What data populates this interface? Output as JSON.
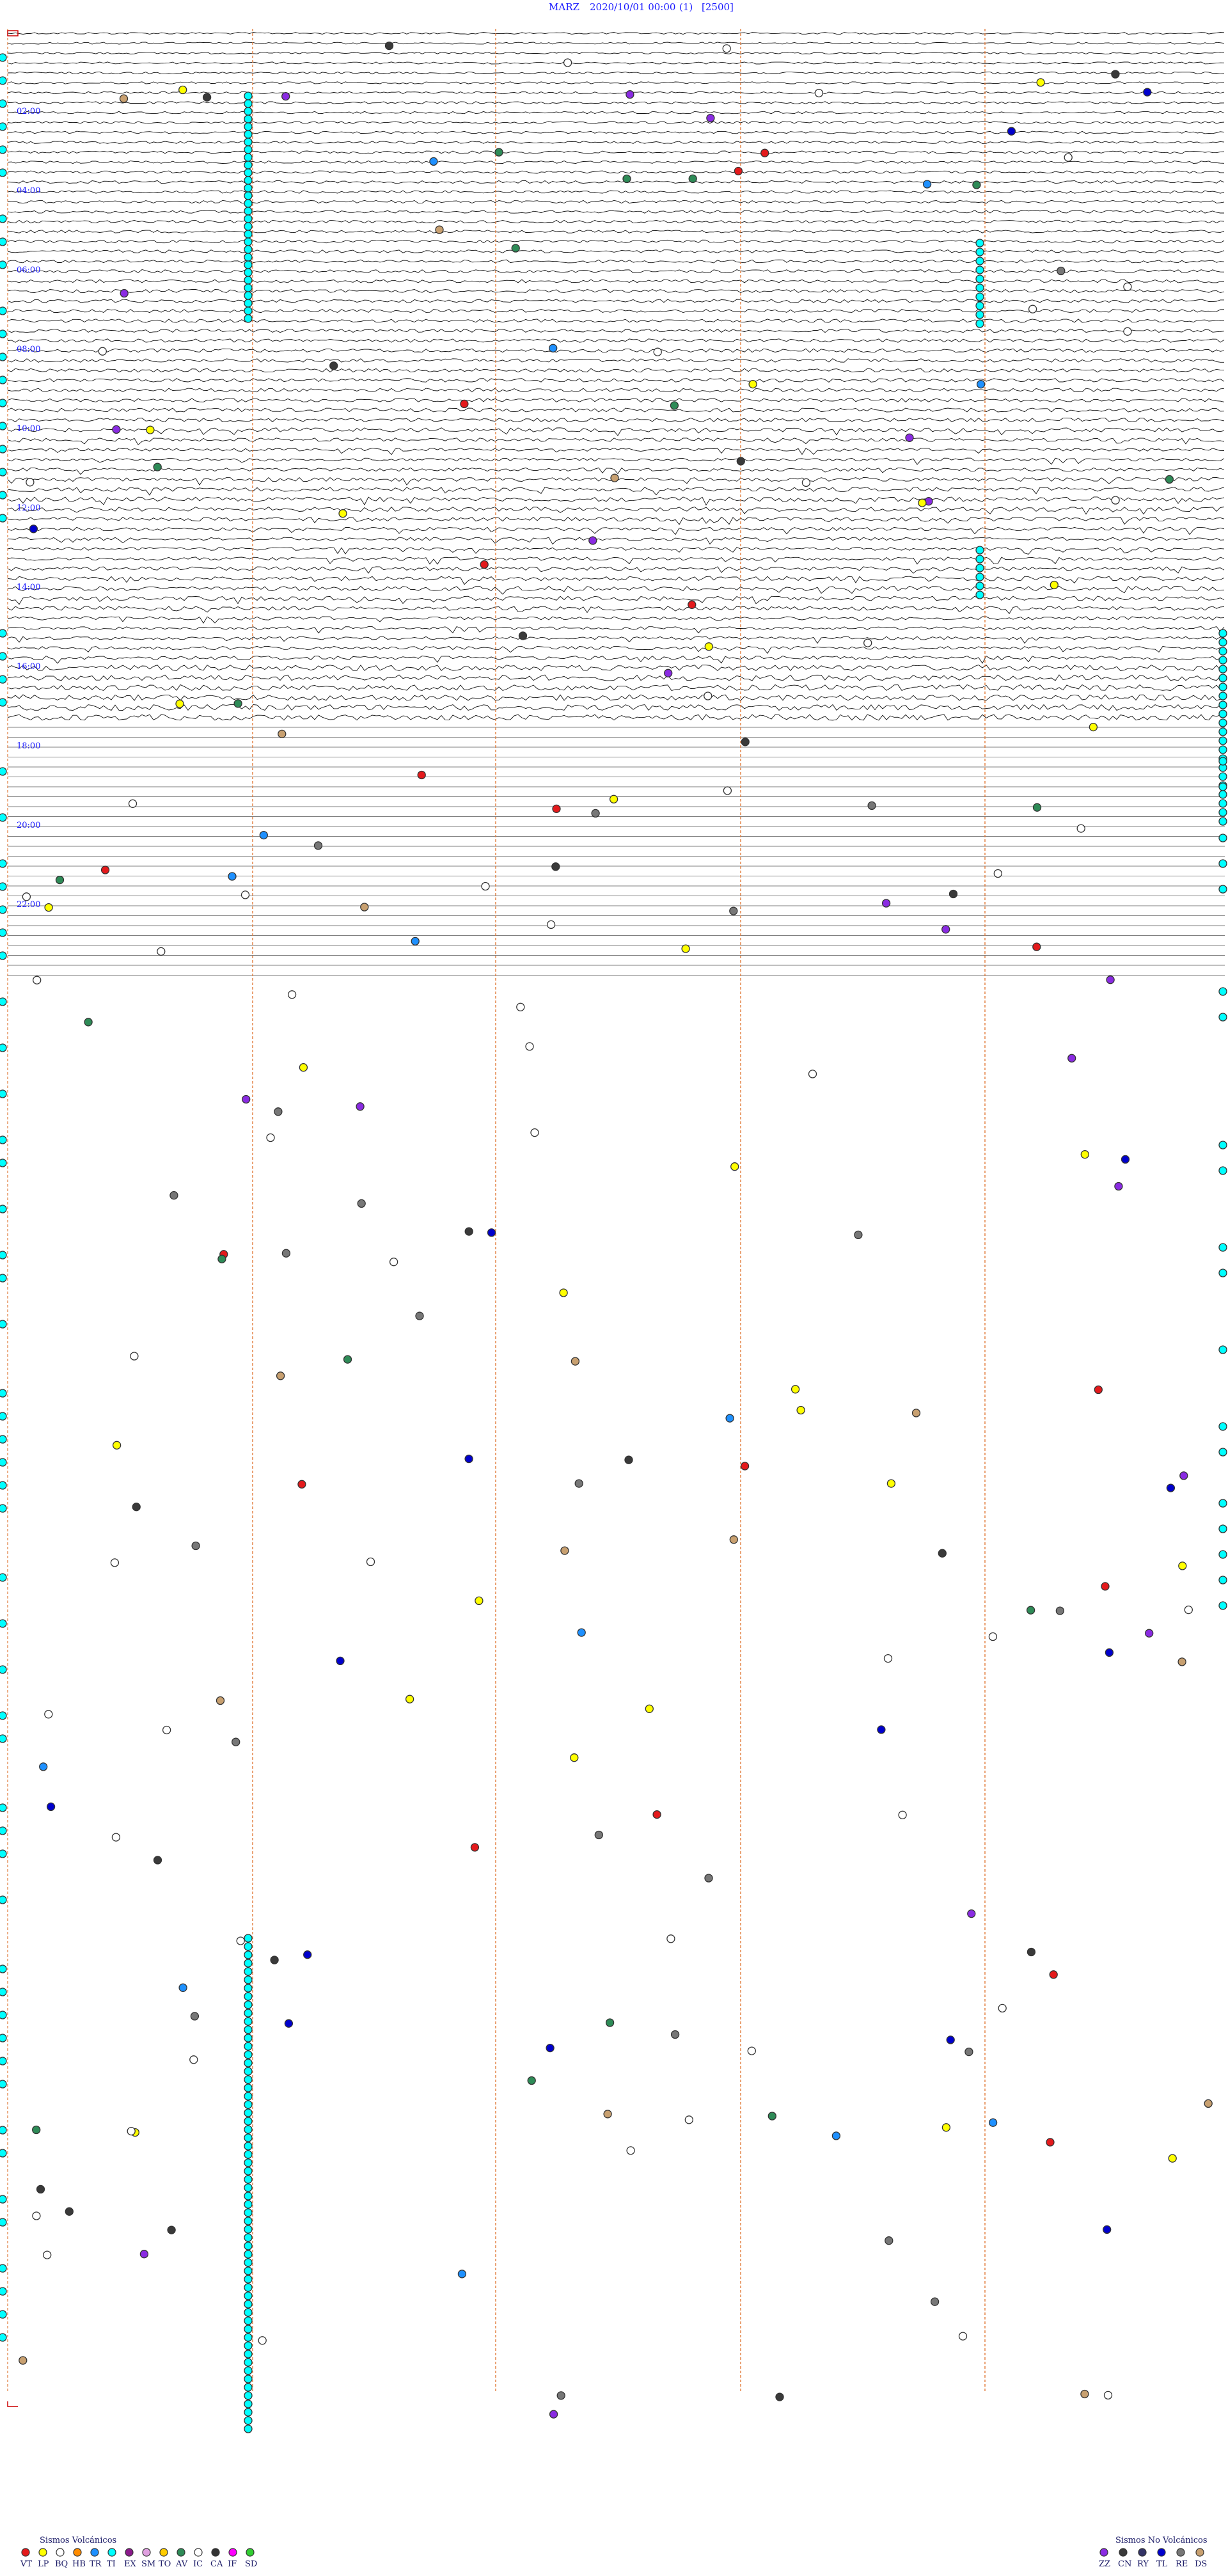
{
  "header": {
    "station": "MARZ",
    "datetime": "2020/10/01 00:00",
    "channel": "(1)",
    "scale": "[2500]"
  },
  "time_labels": [
    "02:00",
    "04:00",
    "06:00",
    "08:00",
    "10:00",
    "12:00",
    "14:00",
    "16:00",
    "18:00",
    "20:00",
    "22:00"
  ],
  "legend": {
    "volcanic_title": "Sismos Volcánicos",
    "volcanic": [
      {
        "code": "VT",
        "color": "#e41a1c"
      },
      {
        "code": "LP",
        "color": "#ffff00"
      },
      {
        "code": "BQ",
        "color": "#ffffff"
      },
      {
        "code": "HB",
        "color": "#ff8c00"
      },
      {
        "code": "TR",
        "color": "#1e90ff"
      },
      {
        "code": "TI",
        "color": "#00ffff"
      },
      {
        "code": "EX",
        "color": "#8b1a8b"
      },
      {
        "code": "SM",
        "color": "#e0a0e0"
      },
      {
        "code": "TO",
        "color": "#ffcc00"
      },
      {
        "code": "AV",
        "color": "#2e8b57"
      },
      {
        "code": "IC",
        "color": "#ffffff"
      },
      {
        "code": "CA",
        "color": "#333333"
      },
      {
        "code": "IF",
        "color": "#ff00ff"
      },
      {
        "code": "SD",
        "color": "#32cd32"
      }
    ],
    "nonvolcanic_title": "Sismos No Volcánicos",
    "nonvolcanic": [
      {
        "code": "ZZ",
        "color": "#8a2be2"
      },
      {
        "code": "CN",
        "color": "#3a3a3a"
      },
      {
        "code": "RY",
        "color": "#333366"
      },
      {
        "code": "TL",
        "color": "#0000cd"
      },
      {
        "code": "RE",
        "color": "#777777"
      },
      {
        "code": "DS",
        "color": "#c8a070"
      }
    ]
  }
}
